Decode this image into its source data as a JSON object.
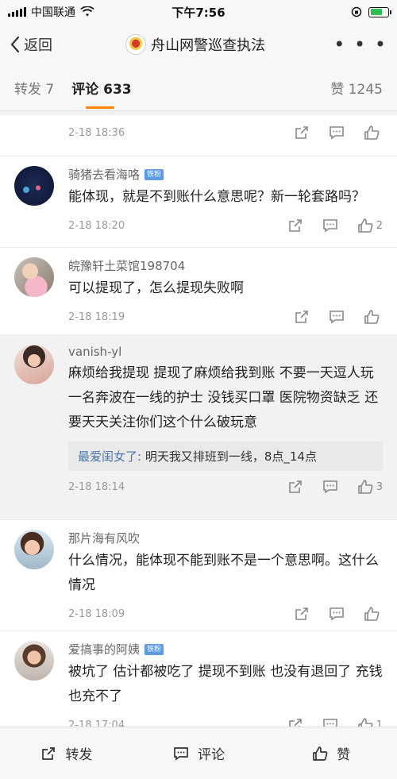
{
  "status_bar": {
    "carrier": "中国联通",
    "time": "下午7:56"
  },
  "nav": {
    "back_label": "返回",
    "title": "舟山网警巡查执法",
    "more_label": "• • •"
  },
  "tabs": {
    "reposts": "转发 7",
    "comments": "评论 633",
    "likes": "赞 1245"
  },
  "comments": [
    {
      "time": "2-18 18:36",
      "likes": ""
    },
    {
      "user": "骑猪去看海咯",
      "badge": "铁粉",
      "text": "能体现，就是不到账什么意思呢？新一轮套路吗？",
      "time": "2-18 18:20",
      "likes": "2"
    },
    {
      "user": "皖豫轩土菜馆198704",
      "text": "可以提现了，怎么提现失败啊",
      "time": "2-18 18:19",
      "likes": ""
    },
    {
      "user": "vanish-yl",
      "text": "麻烦给我提现  提现了麻烦给我到账  不要一天逗人玩  一名奔波在一线的护士  没钱买口罩  医院物资缺乏  还要天天关注你们这个什么破玩意",
      "reply_user": "最爱闺女了:",
      "reply_text": " 明天我又排班到一线，8点_14点",
      "time": "2-18 18:14",
      "likes": "3"
    },
    {
      "user": "那片海有风吹",
      "text": "什么情况，能体现不能到账不是一个意思啊。这什么情况",
      "time": "2-18 18:09",
      "likes": ""
    },
    {
      "user": "爱搞事的阿姨",
      "badge": "铁粉",
      "text": "被坑了  估计都被吃了  提现不到账  也没有退回了  充钱也充不了",
      "time": "2-18 17:04",
      "likes": "1"
    }
  ],
  "bottom_bar": {
    "repost": "转发",
    "comment": "评论",
    "like": "赞"
  },
  "colors": {
    "accent": "#ff8200",
    "link": "#4b76a8",
    "badge": "#5c9be3"
  }
}
